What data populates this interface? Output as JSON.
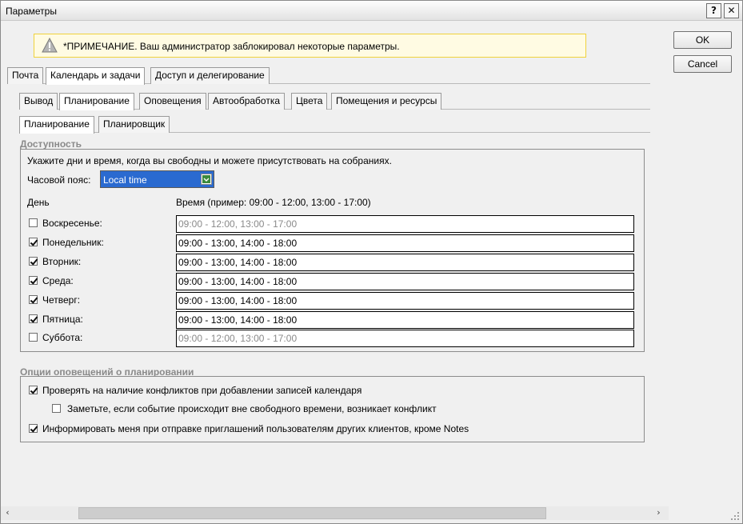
{
  "window": {
    "title": "Параметры",
    "help_label": "?",
    "close_label": "✕"
  },
  "notice": {
    "text": "*ПРИМЕЧАНИЕ. Ваш администратор заблокировал некоторые параметры.",
    "icon": "warning-icon"
  },
  "buttons": {
    "ok": "OK",
    "cancel": "Cancel"
  },
  "tabs_main": [
    "Почта",
    "Календарь и задачи",
    "Доступ и делегирование"
  ],
  "tabs_main_active": "Календарь и задачи",
  "tabs_sub": [
    "Вывод",
    "Планирование",
    "Оповещения",
    "Автообработка",
    "Цвета",
    "Помещения и ресурсы"
  ],
  "tabs_sub_active": "Планирование",
  "tabs_sub2": [
    "Планирование",
    "Планировщик"
  ],
  "tabs_sub2_active": "Планирование",
  "availability": {
    "title": "Доступность",
    "instruction": "Укажите дни и время, когда вы свободны и можете присутствовать на собраниях.",
    "timezone_label": "Часовой пояс:",
    "timezone_value": "Local time",
    "day_header": "День",
    "time_header": "Время (пример: 09:00 - 12:00, 13:00 - 17:00)",
    "days": [
      {
        "label": "Воскресенье:",
        "checked": false,
        "value": "09:00 - 12:00, 13:00 - 17:00",
        "enabled": false
      },
      {
        "label": "Понедельник:",
        "checked": true,
        "value": "09:00 - 13:00, 14:00 - 18:00",
        "enabled": true
      },
      {
        "label": "Вторник:",
        "checked": true,
        "value": "09:00 - 13:00, 14:00 - 18:00",
        "enabled": true
      },
      {
        "label": "Среда:",
        "checked": true,
        "value": "09:00 - 13:00, 14:00 - 18:00",
        "enabled": true
      },
      {
        "label": "Четверг:",
        "checked": true,
        "value": "09:00 - 13:00, 14:00 - 18:00",
        "enabled": true
      },
      {
        "label": "Пятница:",
        "checked": true,
        "value": "09:00 - 13:00, 14:00 - 18:00",
        "enabled": true
      },
      {
        "label": "Суббота:",
        "checked": false,
        "value": "09:00 - 12:00, 13:00 - 17:00",
        "enabled": false
      }
    ]
  },
  "notifications": {
    "title": "Опции оповещений о планировании",
    "options": [
      {
        "label": "Проверять на наличие конфликтов при добавлении записей календаря",
        "checked": true
      },
      {
        "label": "Заметьте, если событие происходит вне свободного времени, возникает конфликт",
        "checked": false
      },
      {
        "label": "Информировать меня при отправке приглашений пользователям других клиентов, кроме Notes",
        "checked": true
      }
    ]
  },
  "scrollbar": {
    "left_arrow": "‹",
    "right_arrow": "›"
  }
}
